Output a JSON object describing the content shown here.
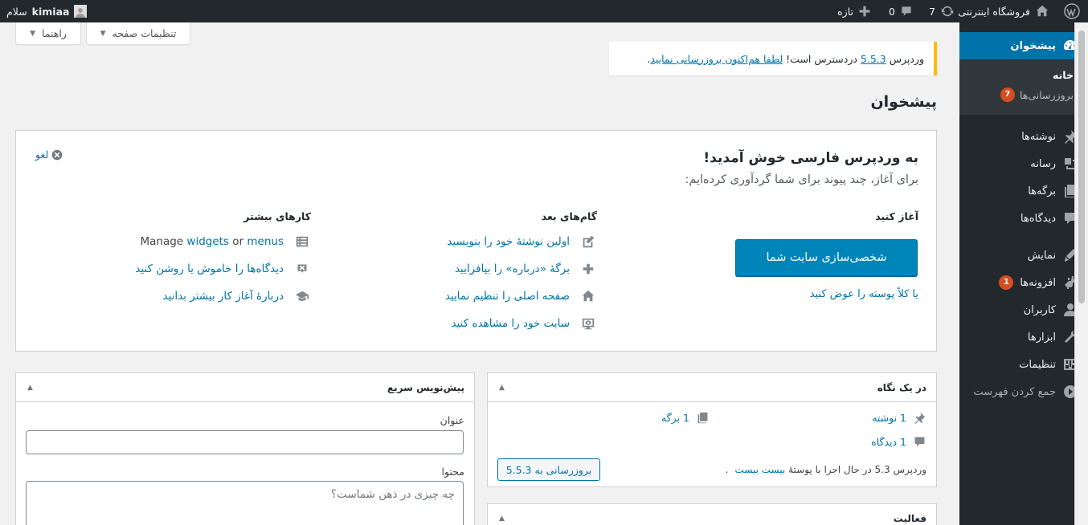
{
  "admin_bar": {
    "site_name": "فروشگاه اینترنتی",
    "updates_count": "7",
    "comments_count": "0",
    "new_label": "تازه",
    "greeting": "سلام",
    "username": "kimiaa"
  },
  "screen_meta": {
    "screen_options": "تنظیمات صفحه",
    "help": "راهنما"
  },
  "notice": {
    "prefix": "وردپرس",
    "version": "5.5.3",
    "middle": "دردسترس است!",
    "link": "لطفا هم‌اکنون بروزرسانی نمایید",
    "suffix": "."
  },
  "page_title": "پیشخوان",
  "sidebar": {
    "dashboard": "پیشخوان",
    "submenu": {
      "home": "خانه",
      "updates": "بروزرسانی‌ها",
      "updates_badge": "7"
    },
    "items": [
      {
        "label": "نوشته‌ها",
        "icon": "pin-icon"
      },
      {
        "label": "رسانه",
        "icon": "media-icon"
      },
      {
        "label": "برگه‌ها",
        "icon": "pages-icon"
      },
      {
        "label": "دیدگاه‌ها",
        "icon": "comments-icon"
      },
      {
        "label": "نمایش",
        "icon": "appearance-icon"
      },
      {
        "label": "افزونه‌ها",
        "icon": "plugins-icon",
        "badge": "1"
      },
      {
        "label": "کاربران",
        "icon": "users-icon"
      },
      {
        "label": "ابزارها",
        "icon": "tools-icon"
      },
      {
        "label": "تنظیمات",
        "icon": "settings-icon"
      },
      {
        "label": "جمع کردن فهرست",
        "icon": "collapse-icon"
      }
    ]
  },
  "welcome": {
    "title": "به وردپرس فارسی خوش آمدید!",
    "about": "برای آغاز، چند پیوند برای شما گردآوری کرده‌ایم:",
    "dismiss": "لغو",
    "get_started": "آغاز کنید",
    "cta": "شخصی‌سازی سایت شما",
    "theme_link": "یا کلاً پوسته را عوض کنید",
    "next_steps": "گام‌های بعد",
    "next_links": [
      "اولین نوشتهٔ خود را بنویسید",
      "برگهٔ «درباره» را بیافزایید",
      "صفحه اصلی را تنظیم نمایید",
      "سایت خود را مشاهده کنید"
    ],
    "more_actions": "کارهای بیشتر",
    "manage": "Manage",
    "widgets": "widgets",
    "or": "or",
    "menus": "menus",
    "comments_toggle": "دیدگاه‌ها را خاموش یا روشن کنید",
    "learn_more": "دربارهٔ آغاز کار بیشتر بدانید"
  },
  "at_a_glance": {
    "title": "در یک نگاه",
    "posts": "1 نوشته",
    "pages": "1 برگه",
    "comments": "1 دیدگاه",
    "running_prefix": "وردپرس 5.3 در حال اجرا با پوستهٔ",
    "theme_name": "بیست بیست",
    "update_button": "بروزرسانی به 5.5.3"
  },
  "quick_draft": {
    "title": "پیش‌نویس سریع",
    "title_label": "عنوان",
    "content_label": "محتوا",
    "content_placeholder": "چه چیزی در ذهن شماست؟"
  },
  "activity": {
    "title": "فعالیت"
  },
  "colors": {
    "admin_bar": "#23282d",
    "accent": "#0073aa",
    "button": "#0085ba",
    "notice_border": "#ffb900",
    "badge": "#d54e21"
  }
}
